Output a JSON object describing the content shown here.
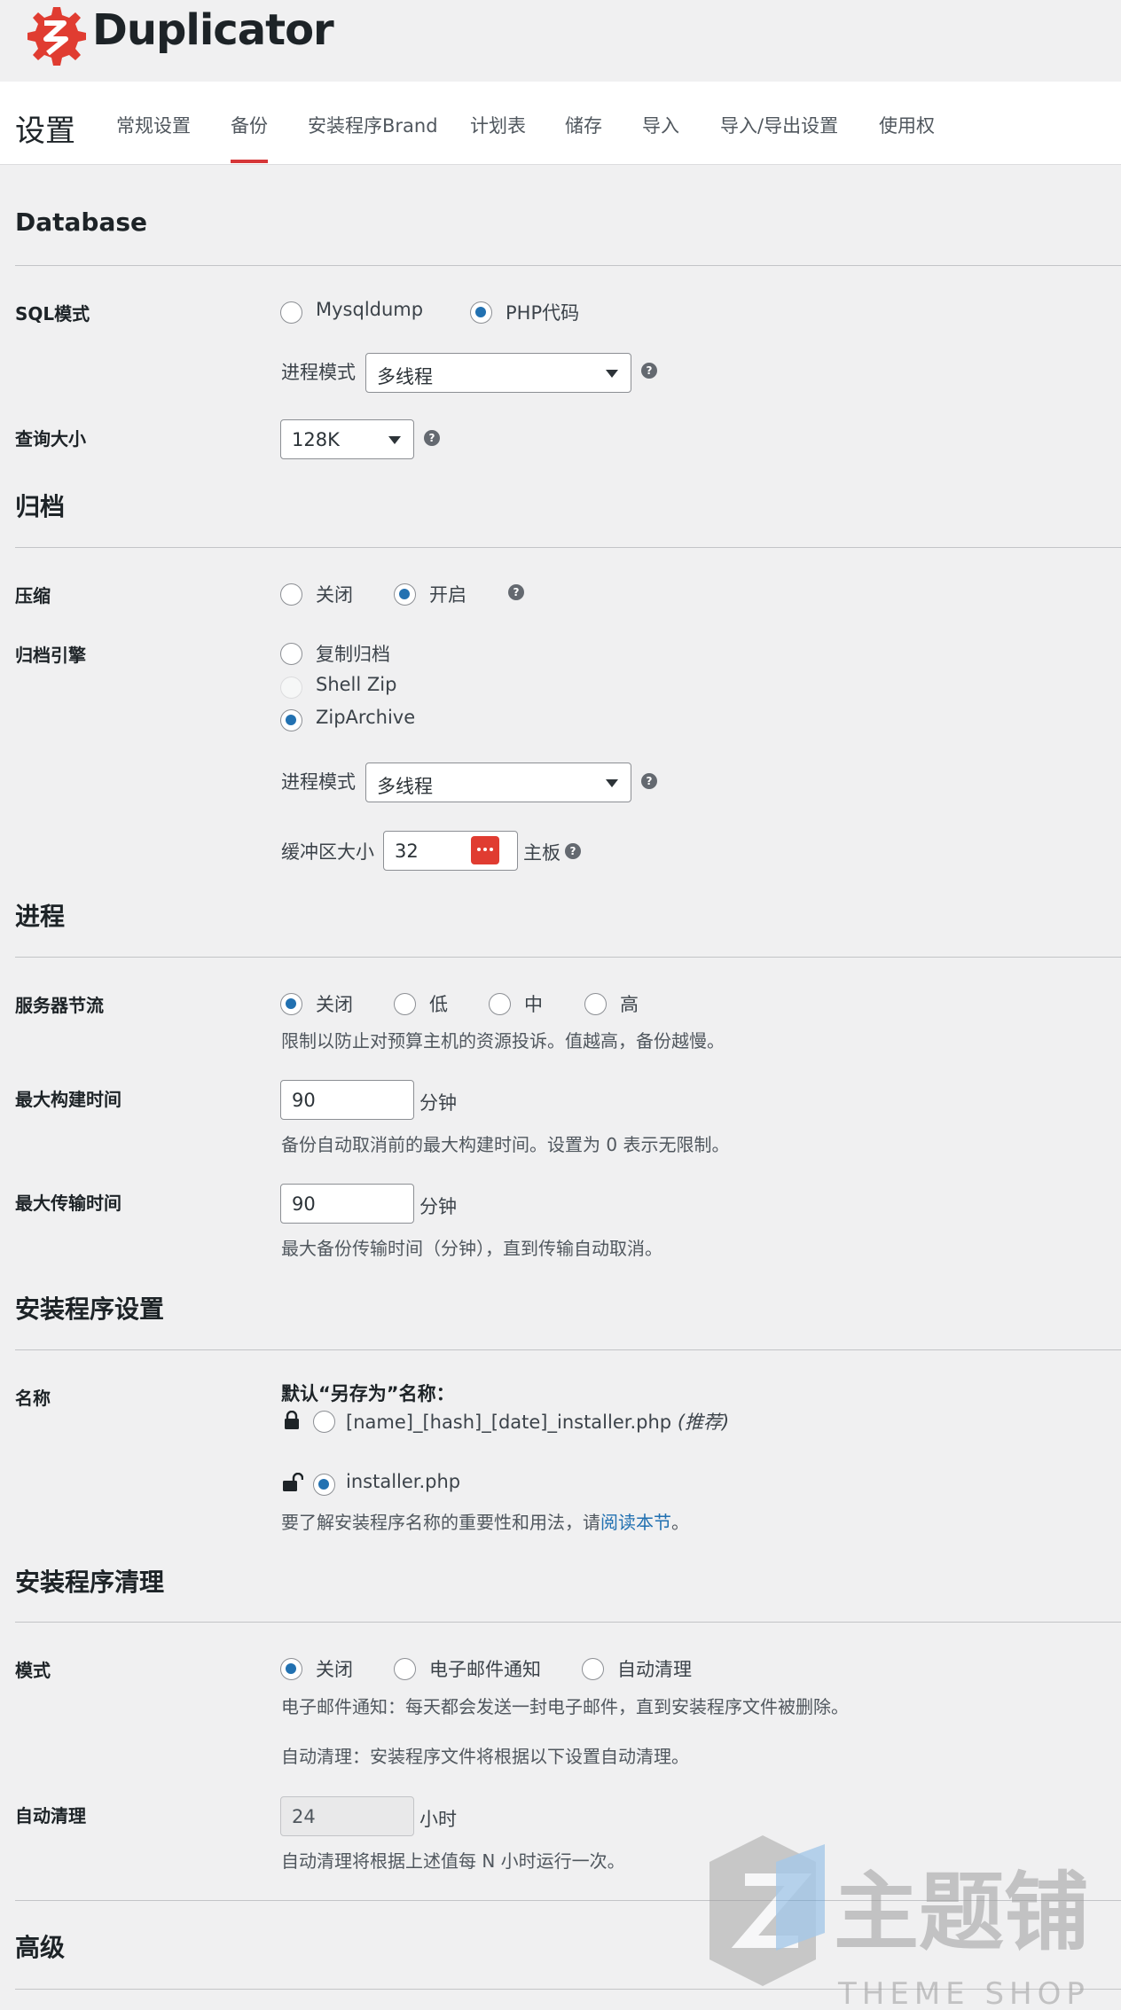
{
  "brand": {
    "name": "Duplicator",
    "color": "#e03c31"
  },
  "nav": {
    "title": "设置",
    "tabs": [
      "常规设置",
      "备份",
      "安装程序Brand",
      "计划表",
      "储存",
      "导入",
      "导入/导出设置",
      "使用权"
    ],
    "active_tab": "备份"
  },
  "database": {
    "title": "Database",
    "sql_mode_label": "SQL模式",
    "sql_options": [
      "Mysqldump",
      "PHP代码"
    ],
    "sql_selected": "PHP代码",
    "process_mode_label": "进程模式",
    "process_mode_value": "多线程",
    "query_size_label": "查询大小",
    "query_size_value": "128K"
  },
  "archive": {
    "title": "归档",
    "compression_label": "压缩",
    "compression_options": [
      "关闭",
      "开启"
    ],
    "compression_selected": "开启",
    "engine_label": "归档引擎",
    "engine_options": [
      "复制归档",
      "Shell Zip",
      "ZipArchive"
    ],
    "engine_selected": "ZipArchive",
    "engine_disabled": "Shell Zip",
    "process_mode_label": "进程模式",
    "process_mode_value": "多线程",
    "buffer_label": "缓冲区大小",
    "buffer_value": "32",
    "buffer_unit": "主板"
  },
  "process": {
    "title": "进程",
    "throttle_label": "服务器节流",
    "throttle_options": [
      "关闭",
      "低",
      "中",
      "高"
    ],
    "throttle_selected": "关闭",
    "throttle_desc": "限制以防止对预算主机的资源投诉。值越高，备份越慢。",
    "max_build_label": "最大构建时间",
    "max_build_value": "90",
    "max_build_unit": "分钟",
    "max_build_desc": "备份自动取消前的最大构建时间。设置为 0 表示无限制。",
    "max_transfer_label": "最大传输时间",
    "max_transfer_value": "90",
    "max_transfer_unit": "分钟",
    "max_transfer_desc": "最大备份传输时间（分钟），直到传输自动取消。"
  },
  "installer": {
    "title": "安装程序设置",
    "name_label": "名称",
    "default_name_heading": "默认“另存为”名称：",
    "option_hashed": "[name]_[hash]_[date]_installer.php",
    "option_hashed_note": "(推荐)",
    "option_plain": "installer.php",
    "selected": "installer.php",
    "desc_prefix": "要了解安装程序名称的重要性和用法，请",
    "desc_link": "阅读本节",
    "desc_suffix": "。"
  },
  "cleanup": {
    "title": "安装程序清理",
    "mode_label": "模式",
    "mode_options": [
      "关闭",
      "电子邮件通知",
      "自动清理"
    ],
    "mode_selected": "关闭",
    "email_desc": "电子邮件通知：每天都会发送一封电子邮件，直到安装程序文件被删除。",
    "auto_desc": "自动清理：安装程序文件将根据以下设置自动清理。",
    "auto_label": "自动清理",
    "auto_value": "24",
    "auto_unit": "小时",
    "auto_run_desc": "自动清理将根据上述值每 N 小时运行一次。"
  },
  "advanced": {
    "title": "高级"
  },
  "watermark": {
    "text_cn": "主题铺",
    "text_en": "THEME SHOP"
  }
}
